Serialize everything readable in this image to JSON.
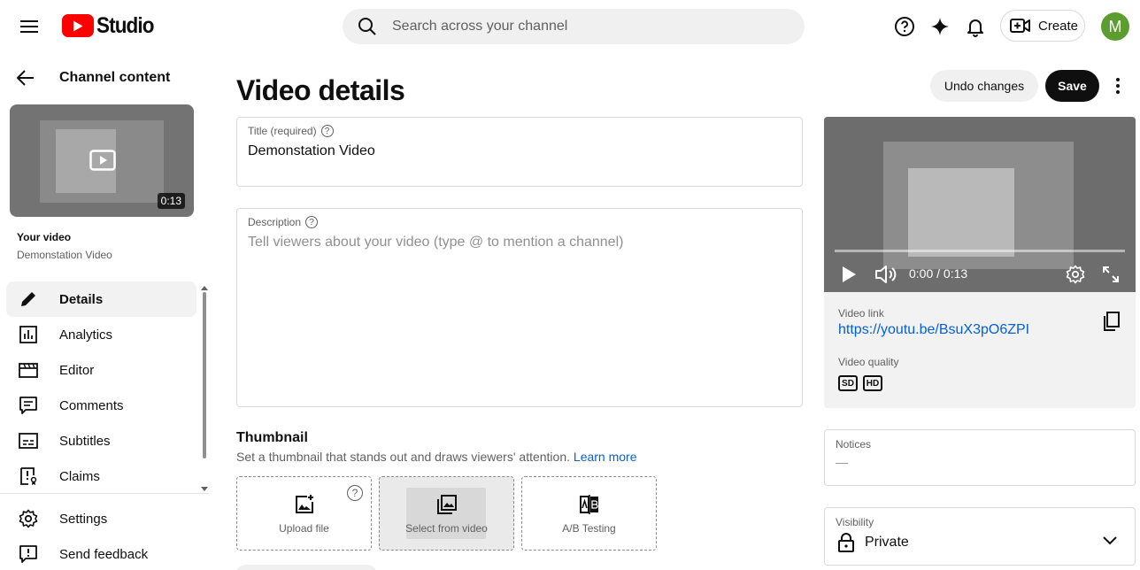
{
  "header": {
    "logo_text": "Studio",
    "search_placeholder": "Search across your channel",
    "create_label": "Create",
    "avatar_letter": "M"
  },
  "sidebar": {
    "back_title": "Channel content",
    "thumb_duration": "0:13",
    "your_video_label": "Your video",
    "video_name": "Demonstation Video",
    "items": [
      {
        "label": "Details",
        "icon": "pencil-icon",
        "active": true
      },
      {
        "label": "Analytics",
        "icon": "analytics-icon"
      },
      {
        "label": "Editor",
        "icon": "clapperboard-icon"
      },
      {
        "label": "Comments",
        "icon": "comment-icon"
      },
      {
        "label": "Subtitles",
        "icon": "subtitles-icon"
      },
      {
        "label": "Claims",
        "icon": "claims-icon"
      }
    ],
    "footer_items": [
      {
        "label": "Settings",
        "icon": "gear-icon"
      },
      {
        "label": "Send feedback",
        "icon": "feedback-icon"
      }
    ]
  },
  "main": {
    "page_title": "Video details",
    "undo_label": "Undo changes",
    "save_label": "Save",
    "title_field": {
      "label": "Title (required)",
      "value": "Demonstation Video"
    },
    "description_field": {
      "label": "Description",
      "placeholder": "Tell viewers about your video (type @ to mention a channel)"
    },
    "thumbnail": {
      "heading": "Thumbnail",
      "subtext": "Set a thumbnail that stands out and draws viewers' attention.",
      "learn_more": "Learn more",
      "options": [
        "Upload file",
        "Select from video",
        "A/B Testing"
      ]
    }
  },
  "right": {
    "player": {
      "time": "0:00 / 0:13",
      "progress": 0
    },
    "video_link_label": "Video link",
    "video_link": "https://youtu.be/BsuX3pO6ZPI",
    "video_quality_label": "Video quality",
    "quality_badges": [
      "SD",
      "HD"
    ],
    "notices_label": "Notices",
    "notices_value": "—",
    "visibility_label": "Visibility",
    "visibility_value": "Private"
  },
  "colors": {
    "brand_red": "#ff0000",
    "link_blue": "#065fd4",
    "avatar_green": "#5b9e2f"
  }
}
